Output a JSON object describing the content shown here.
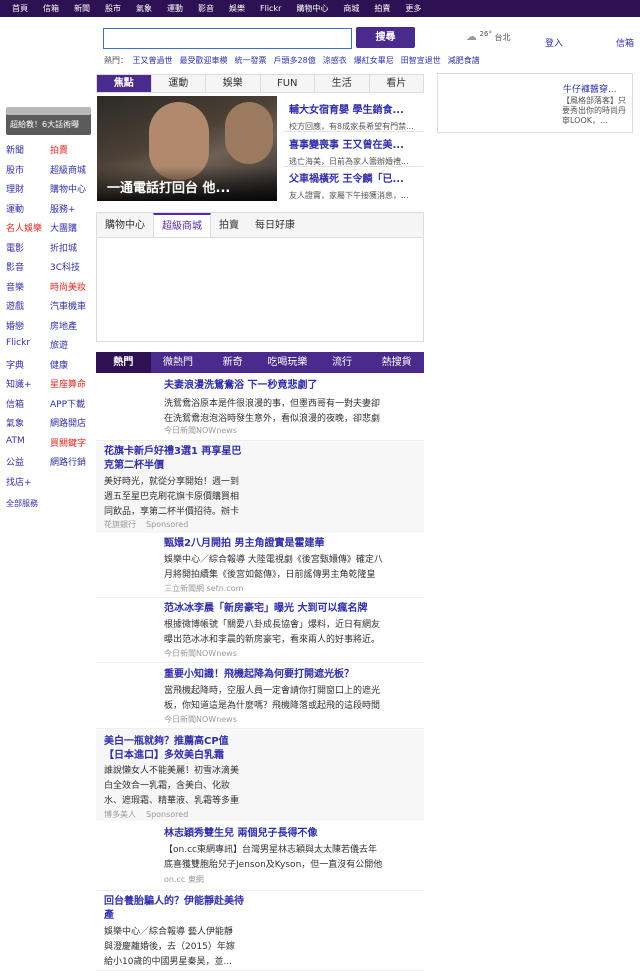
{
  "topnav": [
    "首頁",
    "信箱",
    "新聞",
    "股市",
    "氣象",
    "運動",
    "影音",
    "娛樂",
    "Flickr",
    "購物中心",
    "商城",
    "拍賣",
    "更多"
  ],
  "search": {
    "button": "搜尋",
    "placeholder": ""
  },
  "weather": {
    "temp": "26°",
    "city": "台北"
  },
  "header": {
    "login": "登入",
    "mail": "信箱"
  },
  "hot": {
    "label": "熱門：",
    "items": [
      "王又曾過世",
      "最受歡迎車模",
      "統一發票",
      "戶頭多28億",
      "涼感衣",
      "爆紅女畢尼",
      "田智宣退世",
      "減肥食譜"
    ]
  },
  "banner": "超給教！6大話術曝",
  "leftnav": [
    [
      "新聞",
      "拍賣"
    ],
    [
      "股市",
      "超級商城"
    ],
    [
      "理財",
      "購物中心"
    ],
    [
      "運動",
      "服務+"
    ],
    [
      "名人娛樂",
      "大團購"
    ],
    [
      "電影",
      "折扣城"
    ],
    [
      "影音",
      "3C科技"
    ],
    [
      "音樂",
      "時尚美妝"
    ],
    [
      "遊戲",
      "汽車機車"
    ],
    [
      "婚戀",
      "房地產"
    ],
    [
      "Flickr",
      "旅遊"
    ],
    [
      "字典",
      "健康"
    ],
    [
      "知識+",
      "星座算命"
    ],
    [
      "信箱",
      "APP下載"
    ],
    [
      "氣象",
      "網路開店"
    ],
    [
      "ATM",
      "買關鍵字"
    ],
    [
      "公益",
      "網路行銷"
    ],
    [
      "找店+",
      ""
    ]
  ],
  "leftnav_red": [
    "拍賣",
    "名人娛樂",
    "時尚美妝",
    "星座算命",
    "買關鍵字"
  ],
  "leftnav_more": "全部服務",
  "tabs1": [
    "焦點",
    "運動",
    "娛樂",
    "FUN",
    "生活",
    "看片"
  ],
  "feature": {
    "caption": "一通電話打回台 他...",
    "stories": [
      {
        "title": "輔大女宿育嬰 學生銷食...",
        "desc": "校方回應，有8成家長希望有門禁..."
      },
      {
        "title": "喜事變喪事 王又曾在美...",
        "desc": "逃亡海美，日前為家人籌辦婚禮..."
      },
      {
        "title": "父車禍橫死 王令麟「已...",
        "desc": "友人證實，家屬下午接獲消息，..."
      }
    ]
  },
  "ad": {
    "title": "牛仔褲醬穿...",
    "desc": "【風格部落客】只要秀出你的時尚丹寧LOOK，..."
  },
  "shop_tabs": [
    "購物中心",
    "超級商城",
    "拍賣",
    "每日好康"
  ],
  "tabs2": [
    "熱門",
    "微熱門",
    "新奇",
    "吃喝玩樂",
    "流行",
    "熱搜貨"
  ],
  "feed": [
    {
      "title": "夫妻浪漫洗鴛鴦浴 下一秒竟悲劇了",
      "desc": [
        "洗鴛鴦浴原本是件很浪漫的事，但墨西哥有一對夫妻卻",
        "在洗鴛鴦泡泡浴時發生意外，看似浪漫的夜晚，卻悲劇"
      ],
      "source": "今日新聞NOWnews"
    },
    {
      "title": "花旗卡新戶好禮3選1 再享星巴克第二杯半價",
      "desc": [
        "美好時光，就從分享開始！週一到",
        "週五至星巴克刷花旗卡原價購買相",
        "同飲品，享第二杯半價招待。辦卡"
      ],
      "source": "花旗銀行",
      "sponsored": "Sponsored"
    },
    {
      "title": "甄嬛2八月開拍 男主角證實是霍建華",
      "desc": [
        "娛樂中心／綜合報導 大陸電視劇《後宮甄嬛傳》確定八",
        "月將開拍續集《後宮如懿傳》，日前謠傳男主角乾隆皇"
      ],
      "source": "三立新聞網 setn.com"
    },
    {
      "title": "范冰冰李晨「新房豪宅」曝光 大到可以瘋名牌",
      "desc": [
        "根據微博帳號「關愛八卦成長協會」爆料，近日有網友",
        "曝出范冰冰和李晨的新房豪宅，看來兩人的好事將近。"
      ],
      "source": "今日新聞NOWnews"
    },
    {
      "title": "重要小知識！飛機起降為何要打開遮光板？",
      "desc": [
        "當飛機起降時，空服人員一定會請你打開窗口上的遮光",
        "板，你知道這是為什麼嗎？飛機降落或起飛的這段時間"
      ],
      "source": "今日新聞NOWnews"
    },
    {
      "title": "美白一瓶就夠？推薦高CP值【日本進口】多效美白乳霜",
      "desc": [
        "誰說懶女人不能美麗！初雪冰滴美",
        "白全效合一乳霜，含美白、化妝",
        "水、遮瑕霜、精華液、乳霜等多重"
      ],
      "source": "博多美人",
      "sponsored": "Sponsored"
    },
    {
      "title": "林志穎秀雙生兒 兩個兒子長得不像",
      "desc": [
        "【on.cc東網專訊】台灣男星林志穎與太太陳若儀去年",
        "底喜獲雙胞胎兒子Jenson及Kyson，但一直沒有公開他"
      ],
      "source": "on.cc 東網"
    },
    {
      "title": "回台養胎騙人的？伊能靜赴美待產",
      "desc": [
        "娛樂中心／綜合報導 藝人伊能靜",
        "與澄慶離婚後，去（2015）年嫁",
        "給小10歲的中國男星秦昊，並..."
      ],
      "source": ""
    }
  ],
  "colors": {
    "brand": "#4a2a8c",
    "topbar": "#2d1152",
    "link": "#3230a9",
    "red": "#e0281e"
  }
}
